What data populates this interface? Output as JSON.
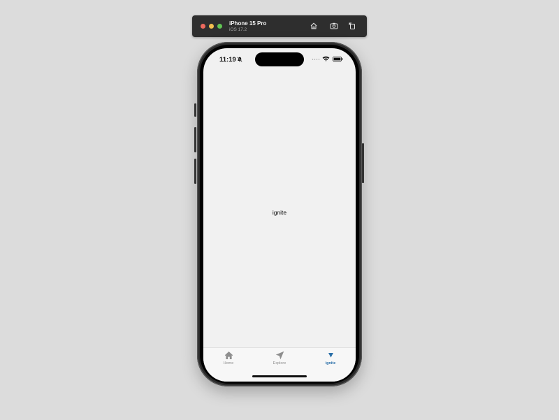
{
  "simulator": {
    "device_name": "iPhone 15 Pro",
    "os_version": "iOS 17.2",
    "toolbar_buttons": [
      "home-icon",
      "screenshot-icon",
      "rotate-icon"
    ]
  },
  "status_bar": {
    "time": "11:19",
    "icons": [
      "bell-slash-icon",
      "signal-icon",
      "wifi-icon",
      "battery-icon"
    ]
  },
  "main": {
    "center_label": "ignite"
  },
  "tab_bar": {
    "tabs": [
      {
        "label": "Home",
        "icon": "home-icon",
        "selected": false
      },
      {
        "label": "Explore",
        "icon": "navigation-arrow-icon",
        "selected": false
      },
      {
        "label": "ignite",
        "icon": "triangle-down-icon",
        "selected": true
      }
    ]
  },
  "colors": {
    "accent": "#2a6fa8",
    "inactive_tab": "#8e8e8e",
    "screen_background": "#f1f1f1",
    "desktop_background": "#dcdcdc"
  }
}
